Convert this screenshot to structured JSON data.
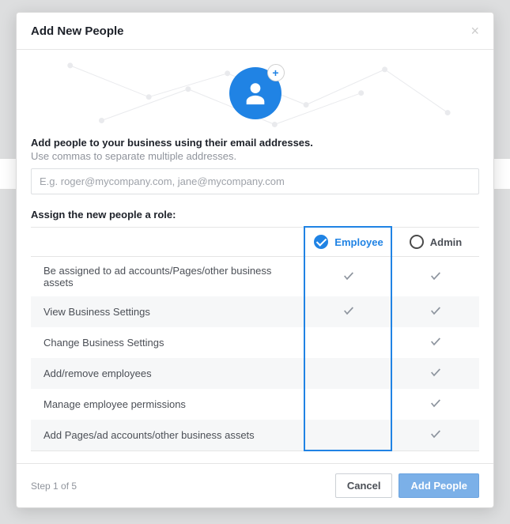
{
  "modal": {
    "title": "Add New People",
    "intro_title": "Add people to your business using their email addresses.",
    "intro_sub": "Use commas to separate multiple addresses.",
    "email_placeholder": "E.g. roger@mycompany.com, jane@mycompany.com",
    "assign_label": "Assign the new people a role:"
  },
  "roles": [
    {
      "key": "employee",
      "label": "Employee",
      "selected": true
    },
    {
      "key": "admin",
      "label": "Admin",
      "selected": false
    }
  ],
  "permissions": [
    {
      "label": "Be assigned to ad accounts/Pages/other business assets",
      "employee": true,
      "admin": true
    },
    {
      "label": "View Business Settings",
      "employee": true,
      "admin": true
    },
    {
      "label": "Change Business Settings",
      "employee": false,
      "admin": true
    },
    {
      "label": "Add/remove employees",
      "employee": false,
      "admin": true
    },
    {
      "label": "Manage employee permissions",
      "employee": false,
      "admin": true
    },
    {
      "label": "Add Pages/ad accounts/other business assets",
      "employee": false,
      "admin": true
    }
  ],
  "footer": {
    "step_text": "Step 1 of 5",
    "cancel_label": "Cancel",
    "primary_label": "Add People"
  }
}
